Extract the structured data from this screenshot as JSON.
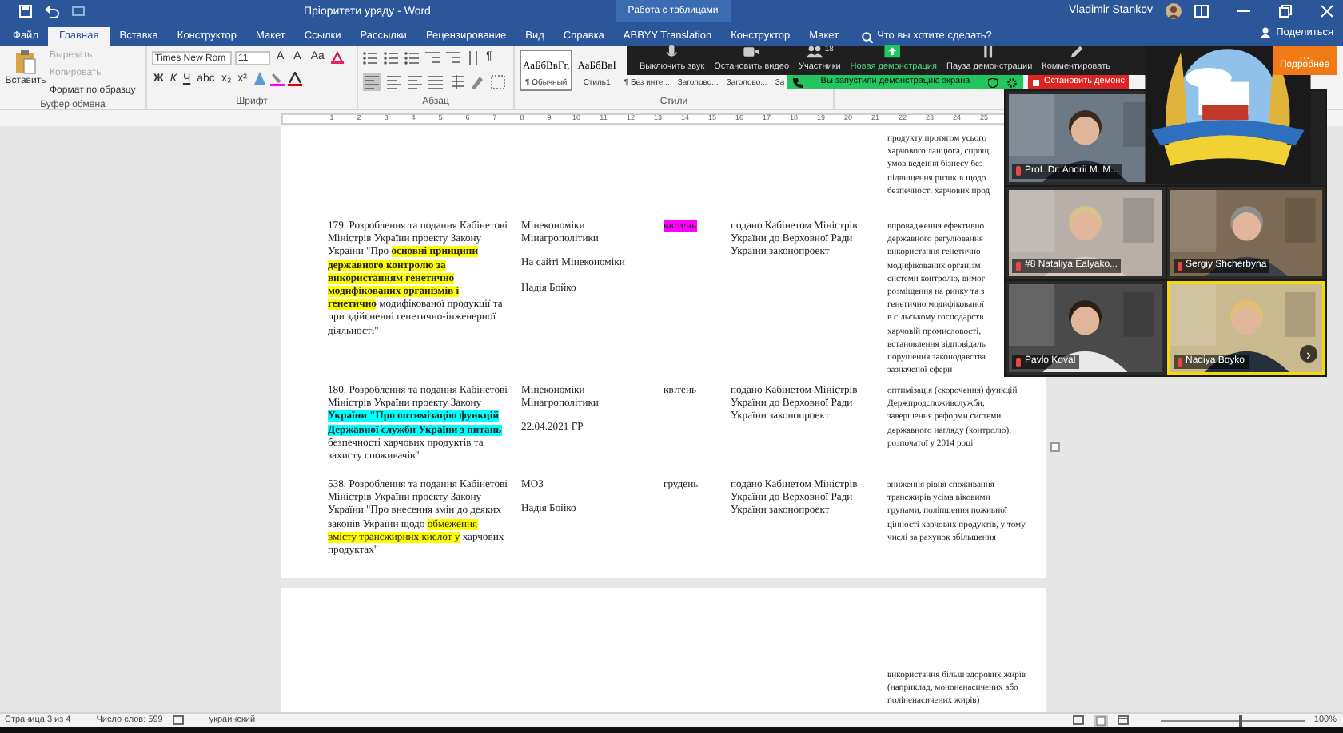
{
  "title_bar": {
    "title": "Пріоритети уряду - Word",
    "context_tab": "Работа с таблицами",
    "user": "Vladimir Stankov"
  },
  "ribbon_tabs": [
    {
      "label": "Файл",
      "selected": false
    },
    {
      "label": "Главная",
      "selected": true
    },
    {
      "label": "Вставка",
      "selected": false
    },
    {
      "label": "Конструктор",
      "selected": false
    },
    {
      "label": "Макет",
      "selected": false
    },
    {
      "label": "Ссылки",
      "selected": false
    },
    {
      "label": "Рассылки",
      "selected": false
    },
    {
      "label": "Рецензирование",
      "selected": false
    },
    {
      "label": "Вид",
      "selected": false
    },
    {
      "label": "Справка",
      "selected": false
    },
    {
      "label": "ABBYY Translation",
      "selected": false
    },
    {
      "label": "Конструктор",
      "selected": false
    },
    {
      "label": "Макет",
      "selected": false
    }
  ],
  "tell_me": "Что вы хотите сделать?",
  "share": "Поделиться",
  "clipboard": {
    "paste": "Вставить",
    "items": [
      {
        "label": "Вырезать",
        "disabled": true
      },
      {
        "label": "Копировать",
        "disabled": true
      },
      {
        "label": "Формат по образцу",
        "disabled": false
      }
    ],
    "group": "Буфер обмена"
  },
  "font": {
    "name": "Times New Rom",
    "size": "11",
    "row1_buttons": [
      "A",
      "A",
      "Aa"
    ],
    "row2_buttons": [
      "Ж",
      "К",
      "Ч",
      "abc",
      "x₂",
      "x²"
    ],
    "group": "Шрифт"
  },
  "paragraph": {
    "mark": "¶",
    "group": "Абзац"
  },
  "styles": {
    "items": [
      {
        "preview": "АаБбВвГг,",
        "label": "¶ Обычный",
        "selected": true
      },
      {
        "preview": "АаБбВвI",
        "label": "Стиль1",
        "selected": false
      },
      {
        "label": "¶ Без инте...",
        "selected": false
      },
      {
        "label": "Заголово...",
        "selected": false
      },
      {
        "label": "Заголово...",
        "selected": false
      },
      {
        "label": "За",
        "selected": false
      }
    ],
    "group": "Стили"
  },
  "ruler": [
    "1",
    "2",
    "3",
    "4",
    "5",
    "6",
    "7",
    "8",
    "9",
    "10",
    "11",
    "12",
    "13",
    "14",
    "15",
    "16",
    "17",
    "18",
    "19",
    "20",
    "21",
    "22",
    "23",
    "24",
    "25"
  ],
  "document": {
    "rows": [
      {
        "result": [
          "продукту протягом усього",
          "харчового ланцюга, спрощ",
          "умов ведення бізнесу без",
          "підвищення ризиків щодо",
          "безпечності харчових прод"
        ]
      },
      {
        "task": [
          {
            "text": "179. Розроблення та подання Кабінетові Міністрів України проекту Закону України \"Про "
          },
          {
            "text": "основні принципи державного контролю за використанням генетично модифікованих організмів і генетично",
            "bold": true,
            "color": "#ffff00"
          },
          {
            "text": " модифікованої продукції та при здійсненні генетично-інженерної діяльності\""
          }
        ],
        "responsible": [
          "Мінекономіки Мінагрополітики",
          "На сайті Мінекономіки",
          "Надія Бойко"
        ],
        "term": {
          "text": "квітень",
          "color": "#ff00ff"
        },
        "status": "подано Кабінетом Міністрів України до Верховної Ради України законопроект",
        "result": [
          "впровадження ефективно",
          "державного регулювання",
          "використання генетично",
          "модифікованих організм",
          "системи контролю, вимог",
          "розміщення на ринку та з",
          "генетично модифікованої",
          "в сільському господарств",
          "харчовій промисловості,",
          "встановлення відповідаль",
          "порушення законодавства",
          "зазначеної сфери"
        ]
      },
      {
        "task": [
          {
            "text": "180. Розроблення та подання Кабінетові Міністрів України проекту Закону "
          },
          {
            "text": "України \"Про оптимізацію функцій Державної служби України з питань",
            "bold": true,
            "color": "#00ffff"
          },
          {
            "text": " безпечності харчових продуктів та захисту споживачів\""
          }
        ],
        "responsible": [
          "Мінекономіки Мінагрополітики",
          "22.04.2021 ГР"
        ],
        "term": {
          "text": "квітень"
        },
        "status": "подано Кабінетом Міністрів України до Верховної Ради України законопроект",
        "result": [
          "оптимізація (скорочення) функцій",
          "Держпродспоживслужби,",
          "завершення реформи системи",
          "державного нагляду (контролю),",
          "розпочатої у 2014  році"
        ]
      },
      {
        "task": [
          {
            "text": "538. Розроблення та подання Кабінетові Міністрів України проекту Закону України \"Про внесення змін до деяких законів України щодо "
          },
          {
            "text": "обмеження вмісту трансжирних кислот у",
            "color": "#ffff00"
          },
          {
            "text": " харчових продуктах\""
          }
        ],
        "responsible": [
          "МОЗ",
          "Надія Бойко"
        ],
        "term": {
          "text": "грудень"
        },
        "status": "подано Кабінетом Міністрів України до Верховної Ради України законопроект",
        "result": [
          "зниження рівня споживання",
          "трансжирів усіма віковими",
          "групами, поліпшення поживної",
          "цінності харчових продуктів, у тому",
          "числі за рахунок збільшення"
        ]
      }
    ],
    "page2": [
      "використання більш здорових жирів",
      "(наприклад, мононенасичених або",
      "поліненасичених жирів)"
    ]
  },
  "zoom": {
    "toolbar": [
      {
        "kind": "mic",
        "label": "Выключить звук"
      },
      {
        "kind": "video",
        "label": "Остановить видео"
      },
      {
        "kind": "participants",
        "label": "Участники",
        "count": "18"
      },
      {
        "kind": "share",
        "label": "Новая демонстрация"
      },
      {
        "kind": "pause",
        "label": "Пауза демонстрации"
      },
      {
        "kind": "annotate",
        "label": "Комментировать"
      }
    ],
    "more": "Подробнее",
    "more_dots": "...",
    "sharing_banner": "Вы запустили демонстрацию экрана",
    "stop_share": "Остановить демонс",
    "tiles": [
      {
        "name": "Prof. Dr. Andrii M. M...",
        "active": false
      },
      {
        "name": "#8 Nataliya Ealyako...",
        "active": false
      },
      {
        "name": "Sergiy Shcherbyna",
        "active": false
      },
      {
        "name": "Pavlo Koval",
        "active": false
      },
      {
        "name": "Nadiya Boyko",
        "active": true
      }
    ],
    "next": "›"
  },
  "status_bar": {
    "page": "Страница 3 из 4",
    "words": "Число слов: 599",
    "language": "украинский",
    "zoom": "100%",
    "zoom_slider": {
      "level": 0.55
    }
  }
}
